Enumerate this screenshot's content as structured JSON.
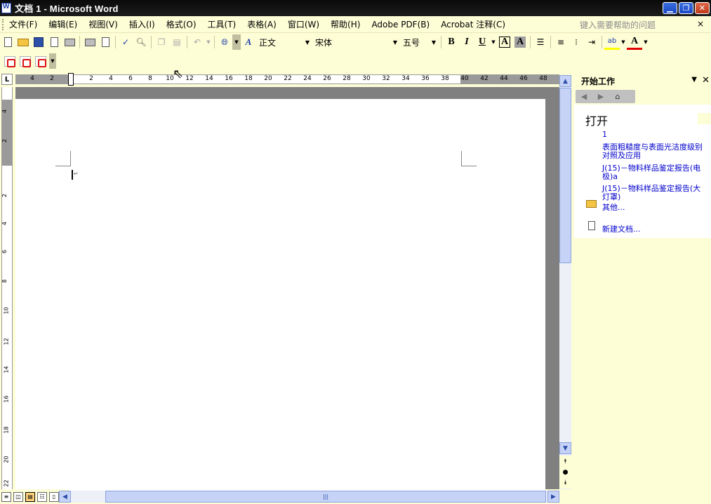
{
  "window": {
    "title": "文档 1 - Microsoft Word"
  },
  "menu": {
    "items": [
      "文件(F)",
      "编辑(E)",
      "视图(V)",
      "插入(I)",
      "格式(O)",
      "工具(T)",
      "表格(A)",
      "窗口(W)",
      "帮助(H)",
      "Adobe PDF(B)",
      "Acrobat 注释(C)"
    ],
    "help_placeholder": "键入需要帮助的问题",
    "help_close": "×"
  },
  "format_toolbar": {
    "style": "正文",
    "font": "宋体",
    "size": "五号",
    "bold": "B",
    "italic": "I",
    "underline": "U",
    "char_border": "A",
    "char_shading": "A",
    "font_color": "A"
  },
  "ruler": {
    "corner_label": "L",
    "h_ticks": [
      "4",
      "2",
      "2",
      "4",
      "6",
      "8",
      "10",
      "12",
      "14",
      "16",
      "18",
      "20",
      "22",
      "24",
      "26",
      "28",
      "30",
      "32",
      "34",
      "36",
      "38",
      "40",
      "42",
      "44",
      "46",
      "48"
    ],
    "v_ticks": [
      "4",
      "2",
      "2",
      "4",
      "6",
      "8",
      "10",
      "12",
      "14",
      "16",
      "18",
      "20",
      "22"
    ]
  },
  "taskpane": {
    "title": "开始工作",
    "section": "打开",
    "recent_files": [
      "1",
      "表面粗糙度与表面光洁度级别",
      "对照及应用",
      "J(15)－物料样品鉴定报告(电",
      "极)a",
      "J(15)－物料样品鉴定报告(大",
      "灯罩)"
    ],
    "more_link": "其他...",
    "new_doc_link": "新建文档..."
  },
  "colors": {
    "titlebar": "#111111",
    "toolbar_bg": "#fdfdd6",
    "link": "#0000cc",
    "scrollbar": "#c6d3f7"
  }
}
